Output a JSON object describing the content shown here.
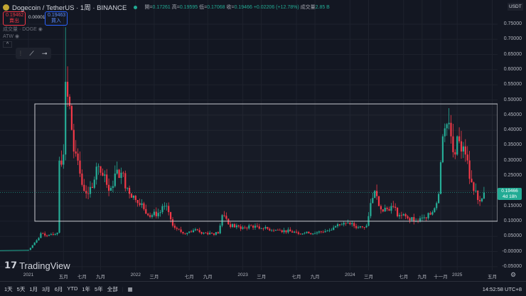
{
  "header": {
    "symbol": "Dogecoin / TetherUS · 1周 · BINANCE",
    "open_label": "開",
    "open": "0.17261",
    "high_label": "高",
    "high": "0.19595",
    "low_label": "低",
    "low": "0.17068",
    "close_label": "收",
    "close": "0.19466",
    "change": "+0.02206 (+12.78%)",
    "volume_label": "成交量",
    "volume": "2.85 B"
  },
  "trade": {
    "sell_price": "0.19462",
    "sell_label": "賣出",
    "spread": "0.00001",
    "buy_price": "0.19463",
    "buy_label": "買入"
  },
  "indicators": [
    {
      "label": "成交量 · DOGE"
    },
    {
      "label": "ATW"
    }
  ],
  "currency": "USDT",
  "price_tag": {
    "price": "0.19466",
    "countdown": "4d 18h"
  },
  "logo": "TradingView",
  "y_ticks": [
    "0.75000",
    "0.70000",
    "0.65000",
    "0.60000",
    "0.55000",
    "0.50000",
    "0.45000",
    "0.40000",
    "0.35000",
    "0.30000",
    "0.25000",
    "0.20000",
    "0.15000",
    "0.10000",
    "0.05000",
    "-0.00000",
    "-0.05000"
  ],
  "x_ticks": [
    {
      "label": "2021",
      "w": 0
    },
    {
      "label": "五月",
      "w": 17
    },
    {
      "label": "七月",
      "w": 26
    },
    {
      "label": "九月",
      "w": 35
    },
    {
      "label": "2022",
      "w": 52
    },
    {
      "label": "三月",
      "w": 61
    },
    {
      "label": "七月",
      "w": 78
    },
    {
      "label": "九月",
      "w": 87
    },
    {
      "label": "2023",
      "w": 104
    },
    {
      "label": "三月",
      "w": 113
    },
    {
      "label": "七月",
      "w": 130
    },
    {
      "label": "九月",
      "w": 139
    },
    {
      "label": "2024",
      "w": 156
    },
    {
      "label": "三月",
      "w": 165
    },
    {
      "label": "七月",
      "w": 182
    },
    {
      "label": "九月",
      "w": 191
    },
    {
      "label": "十一月",
      "w": 200
    },
    {
      "label": "2025",
      "w": 208
    },
    {
      "label": "五月",
      "w": 225
    }
  ],
  "ranges": [
    "1天",
    "5天",
    "1月",
    "3月",
    "6月",
    "YTD",
    "1年",
    "5年",
    "全部"
  ],
  "clock": "14:52:58 UTC+8",
  "colors": {
    "up": "#22ab94",
    "down": "#f23645",
    "bg": "#131722"
  },
  "chart_data": {
    "type": "candlestick",
    "interval": "weekly",
    "ylim": [
      -0.05,
      0.75
    ],
    "rectangle": {
      "top": 0.487,
      "bottom": 0.1
    },
    "anchors": [
      [
        0,
        0.005
      ],
      [
        4,
        0.037
      ],
      [
        6,
        0.06
      ],
      [
        10,
        0.055
      ],
      [
        14,
        0.062
      ],
      [
        15,
        0.3
      ],
      [
        17,
        0.32
      ],
      [
        18,
        0.56
      ],
      [
        20,
        0.48
      ],
      [
        22,
        0.33
      ],
      [
        24,
        0.3
      ],
      [
        26,
        0.22
      ],
      [
        29,
        0.19
      ],
      [
        31,
        0.21
      ],
      [
        33,
        0.28
      ],
      [
        35,
        0.26
      ],
      [
        38,
        0.22
      ],
      [
        40,
        0.21
      ],
      [
        43,
        0.27
      ],
      [
        45,
        0.26
      ],
      [
        48,
        0.21
      ],
      [
        52,
        0.17
      ],
      [
        56,
        0.14
      ],
      [
        60,
        0.12
      ],
      [
        64,
        0.13
      ],
      [
        66,
        0.15
      ],
      [
        68,
        0.13
      ],
      [
        70,
        0.085
      ],
      [
        75,
        0.06
      ],
      [
        80,
        0.07
      ],
      [
        85,
        0.062
      ],
      [
        92,
        0.06
      ],
      [
        94,
        0.12
      ],
      [
        97,
        0.09
      ],
      [
        100,
        0.08
      ],
      [
        104,
        0.08
      ],
      [
        110,
        0.085
      ],
      [
        116,
        0.075
      ],
      [
        122,
        0.07
      ],
      [
        130,
        0.063
      ],
      [
        136,
        0.06
      ],
      [
        140,
        0.063
      ],
      [
        146,
        0.07
      ],
      [
        150,
        0.09
      ],
      [
        156,
        0.09
      ],
      [
        160,
        0.08
      ],
      [
        164,
        0.085
      ],
      [
        166,
        0.16
      ],
      [
        168,
        0.2
      ],
      [
        170,
        0.15
      ],
      [
        174,
        0.14
      ],
      [
        176,
        0.15
      ],
      [
        180,
        0.12
      ],
      [
        184,
        0.11
      ],
      [
        188,
        0.1
      ],
      [
        193,
        0.11
      ],
      [
        196,
        0.13
      ],
      [
        199,
        0.19
      ],
      [
        201,
        0.38
      ],
      [
        203,
        0.42
      ],
      [
        205,
        0.38
      ],
      [
        207,
        0.32
      ],
      [
        208,
        0.38
      ],
      [
        210,
        0.33
      ],
      [
        212,
        0.32
      ],
      [
        214,
        0.24
      ],
      [
        216,
        0.2
      ],
      [
        218,
        0.17
      ],
      [
        220,
        0.175
      ],
      [
        221,
        0.19466
      ]
    ]
  }
}
